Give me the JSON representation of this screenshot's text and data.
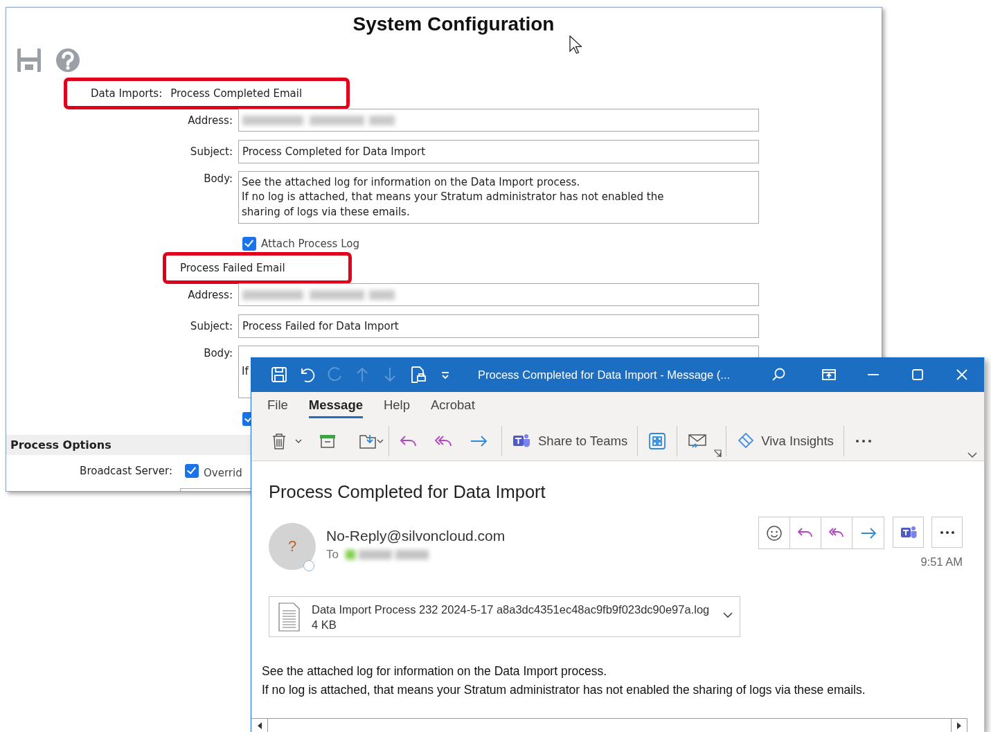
{
  "config_window": {
    "title": "System Configuration",
    "sections": [
      {
        "prefix": "Data Imports:",
        "title": "Process Completed Email",
        "highlighted": true,
        "address_label": "Address:",
        "subject_label": "Subject:",
        "subject": "Process Completed for Data Import",
        "body_label": "Body:",
        "body": "See the attached log for information on the Data Import process.\nIf no log is attached, that means your Stratum administrator has not enabled the\nsharing of logs via these emails.",
        "attach_log": {
          "label": "Attach Process Log",
          "checked": true
        }
      },
      {
        "title": "Process Failed Email",
        "highlighted": true,
        "address_label": "Address:",
        "subject_label": "Subject:",
        "subject": "Process Failed for Data Import",
        "body_label": "Body:",
        "body": "If",
        "attach_log": {
          "checked": true
        }
      }
    ],
    "process_options": {
      "title": "Process Options",
      "broadcast_label": "Broadcast Server:",
      "override_label": "Overrid",
      "override_checked": true
    }
  },
  "email_window": {
    "title": "Process Completed for Data Import  -  Message (...",
    "menu_tabs": [
      {
        "label": "File",
        "selected": false
      },
      {
        "label": "Message",
        "selected": true
      },
      {
        "label": "Help",
        "selected": false
      },
      {
        "label": "Acrobat",
        "selected": false
      }
    ],
    "ribbon": {
      "share_label": "Share to Teams",
      "insights_label": "Viva Insights"
    },
    "subject": "Process Completed for Data Import",
    "avatar": "?",
    "sender": "No-Reply@silvoncloud.com",
    "to_label": "To",
    "time": "9:51 AM",
    "attachment": {
      "name": "Data Import Process 232 2024-5-17 a8a3dc4351ec48ac9fb9f023dc90e97a.log",
      "size": "4 KB"
    },
    "body": [
      "See the attached log for information on the Data Import process.",
      "If no log is attached, that means your Stratum administrator has not enabled the sharing of logs via these emails."
    ]
  }
}
